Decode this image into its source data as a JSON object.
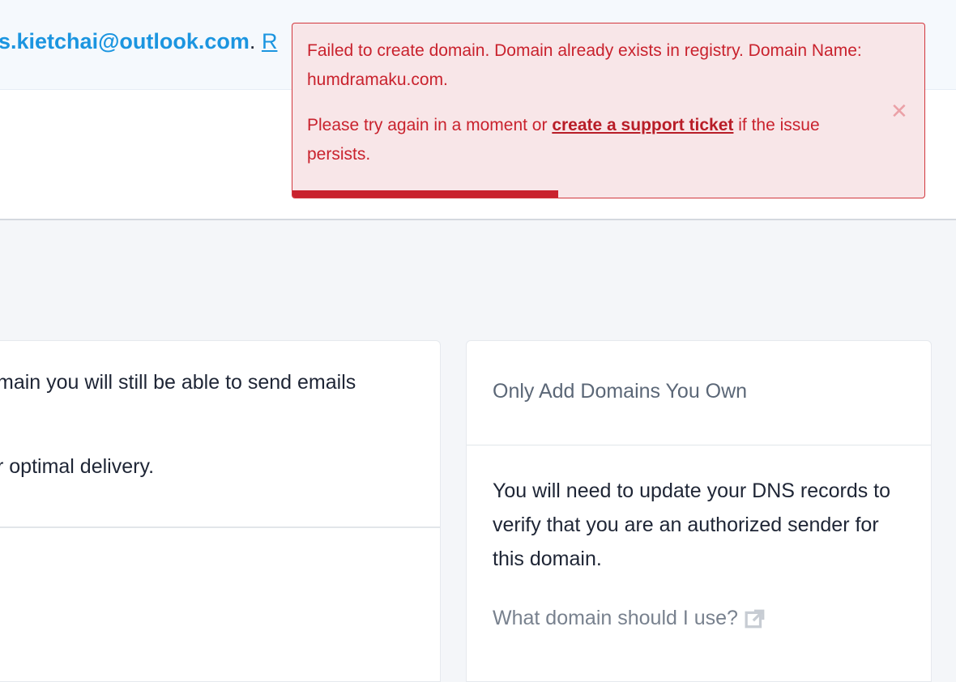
{
  "banner": {
    "email": "s.kietchai@outlook.com",
    "separator": ".",
    "link_partial": "R"
  },
  "left_card": {
    "line1": "main you will still be able to send emails",
    "line2": "r optimal delivery."
  },
  "right_card": {
    "title": "Only Add Domains You Own",
    "body": "You will need to update your DNS records to verify that you are an authorized sender for this domain.",
    "help_link": "What domain should I use?",
    "help_icon": "external-link-icon"
  },
  "toast": {
    "message": "Failed to create domain. Domain already exists in registry. Domain Name: humdramaku.com.",
    "hint_prefix": "Please try again in a moment or ",
    "hint_link": "create a support ticket",
    "hint_suffix": " if the issue persists.",
    "close_icon": "close-icon",
    "progress": 0.42,
    "color": "#c9222d"
  }
}
